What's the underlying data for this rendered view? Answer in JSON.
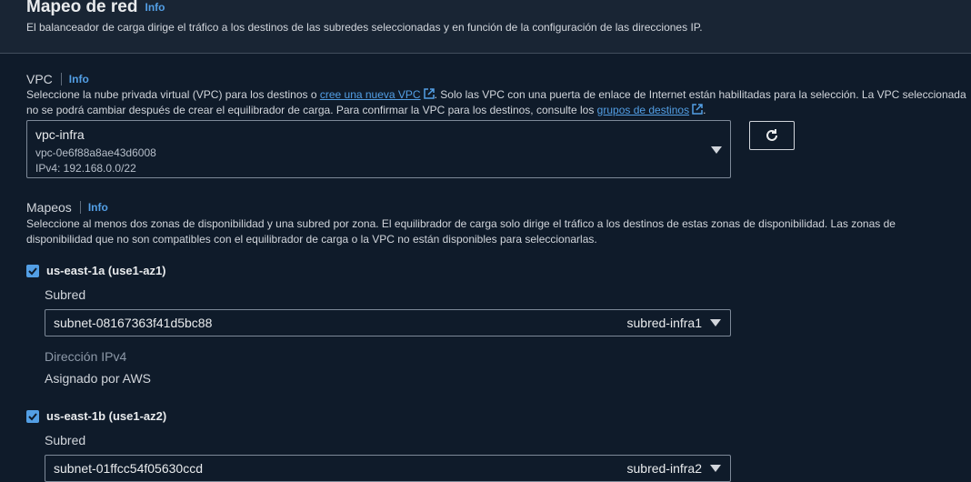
{
  "header": {
    "title": "Mapeo de red",
    "info": "Info",
    "description": "El balanceador de carga dirige el tráfico a los destinos de las subredes seleccionadas y en función de la configuración de las direcciones IP."
  },
  "vpc": {
    "label": "VPC",
    "info": "Info",
    "desc_part1": "Seleccione la nube privada virtual (VPC) para los destinos o ",
    "link_create": "cree una nueva VPC",
    "desc_part2": ". Solo las VPC con una puerta de enlace de Internet están habilitadas para la selección. La VPC seleccionada",
    "desc_part3": "no se podrá cambiar después de crear el equilibrador de carga. Para confirmar la VPC para los destinos, consulte los ",
    "link_groups": "grupos de destinos",
    "desc_part4": ".",
    "selected_name": "vpc-infra",
    "selected_id": "vpc-0e6f88a8ae43d6008",
    "selected_ipv4": "IPv4: 192.168.0.0/22"
  },
  "mappings": {
    "label": "Mapeos",
    "info": "Info",
    "desc_line1": "Seleccione al menos dos zonas de disponibilidad y una subred por zona. El equilibrador de carga solo dirige el tráfico a los destinos de estas zonas de disponibilidad. Las zonas de",
    "desc_line2": "disponibilidad que no son compatibles con el equilibrador de carga o la VPC no están disponibles para seleccionarlas.",
    "zones": [
      {
        "name": "us-east-1a (use1-az1)",
        "subnet_label": "Subred",
        "subnet_id": "subnet-08167363f41d5bc88",
        "subnet_name": "subred-infra1",
        "ipv4_label": "Dirección IPv4",
        "ipv4_value": "Asignado por AWS"
      },
      {
        "name": "us-east-1b (use1-az2)",
        "subnet_label": "Subred",
        "subnet_id": "subnet-01ffcc54f05630ccd",
        "subnet_name": "subred-infra2"
      }
    ]
  },
  "colors": {
    "background": "#0f1b2a",
    "header": "#192534",
    "link": "#539fe5",
    "text": "#d1d5db"
  }
}
